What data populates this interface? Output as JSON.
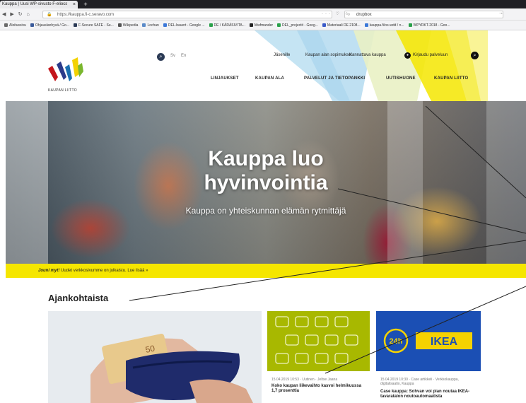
{
  "browser": {
    "tab_title": "Kauppa | Uusi WP-sivusto F-eliocs",
    "tab_close": "×",
    "new_tab": "+",
    "url": "https://kauppa.fi-c.seravo.com",
    "url_actions": "··· ♡ ☆",
    "search_placeholder": "drupbox",
    "bookmarks": [
      {
        "label": "Aloitussivu",
        "color": "#6a6a6a"
      },
      {
        "label": "Ohjauslanhyvä / Go...",
        "color": "#3a5a9a"
      },
      {
        "label": "F-Secure SAFE - Su...",
        "color": "#2b3a55"
      },
      {
        "label": "Wikipedia",
        "color": "#555555"
      },
      {
        "label": "Lochan",
        "color": "#5a8ac8"
      },
      {
        "label": "DEL-bauert - Google ...",
        "color": "#3c78d8"
      },
      {
        "label": "DE / KÄRÄSIVITA...",
        "color": "#2aa14a"
      },
      {
        "label": "Mwfmander",
        "color": "#222222"
      },
      {
        "label": "DEL_projectit - Goog...",
        "color": "#2aa14a"
      },
      {
        "label": "Materiaali DE 2108...",
        "color": "#3a5ac8"
      },
      {
        "label": "kauppa.fi/os-wdd / n...",
        "color": "#3c78d8"
      },
      {
        "label": "WPYRKT-2018 - Goo...",
        "color": "#2aa14a"
      }
    ]
  },
  "site": {
    "logo_text": "KAUPAN LIITTO",
    "lang_sv": "Sv",
    "lang_en": "En",
    "utility_links": [
      "Jäsenille",
      "Kaupan alan sopimukset",
      "Kannattava kauppa"
    ],
    "login_label": "Kirjaudu palveluun",
    "main_nav": [
      "LINJAUKSET",
      "KAUPAN ALA",
      "PALVELUT JA TIETOPANKKI",
      "UUTISHUONE",
      "KAUPAN LIITTO"
    ],
    "hero": {
      "title_line1": "Kauppa luo",
      "title_line2": "hyvinvointia",
      "subtitle": "Kauppa on yhteiskunnan elämän rytmittäjä"
    },
    "notice": {
      "bold": "Jouni myt!",
      "text": "Uudet verkkosivumme on julkaistu. Lue lisää »"
    },
    "news": {
      "heading": "Ajankohtaista",
      "cards": [
        {
          "meta": "15.04.2019 10:53  ·  Uutinen  ·  Jeltse Jaana",
          "title": "Koko kaupan liikevaihto kasvoi helmikuussa 1,7 prosenttia"
        },
        {
          "meta": "15.04.2019 10:30  ·  Case artikkeli  ·  Verkkokauppa, digitalisaatio, Kauppa",
          "title": "Case kauppa: Sohvan voi pian noutaa IKEA-tavaratalon noutoautomaatista",
          "badge": "24h",
          "brand": "IKEA"
        }
      ]
    }
  },
  "colors": {
    "accent_yellow": "#f5e600",
    "nav_dark": "#2b3a55",
    "green_card": "#a8b800",
    "blue_card": "#1b4fb4"
  }
}
